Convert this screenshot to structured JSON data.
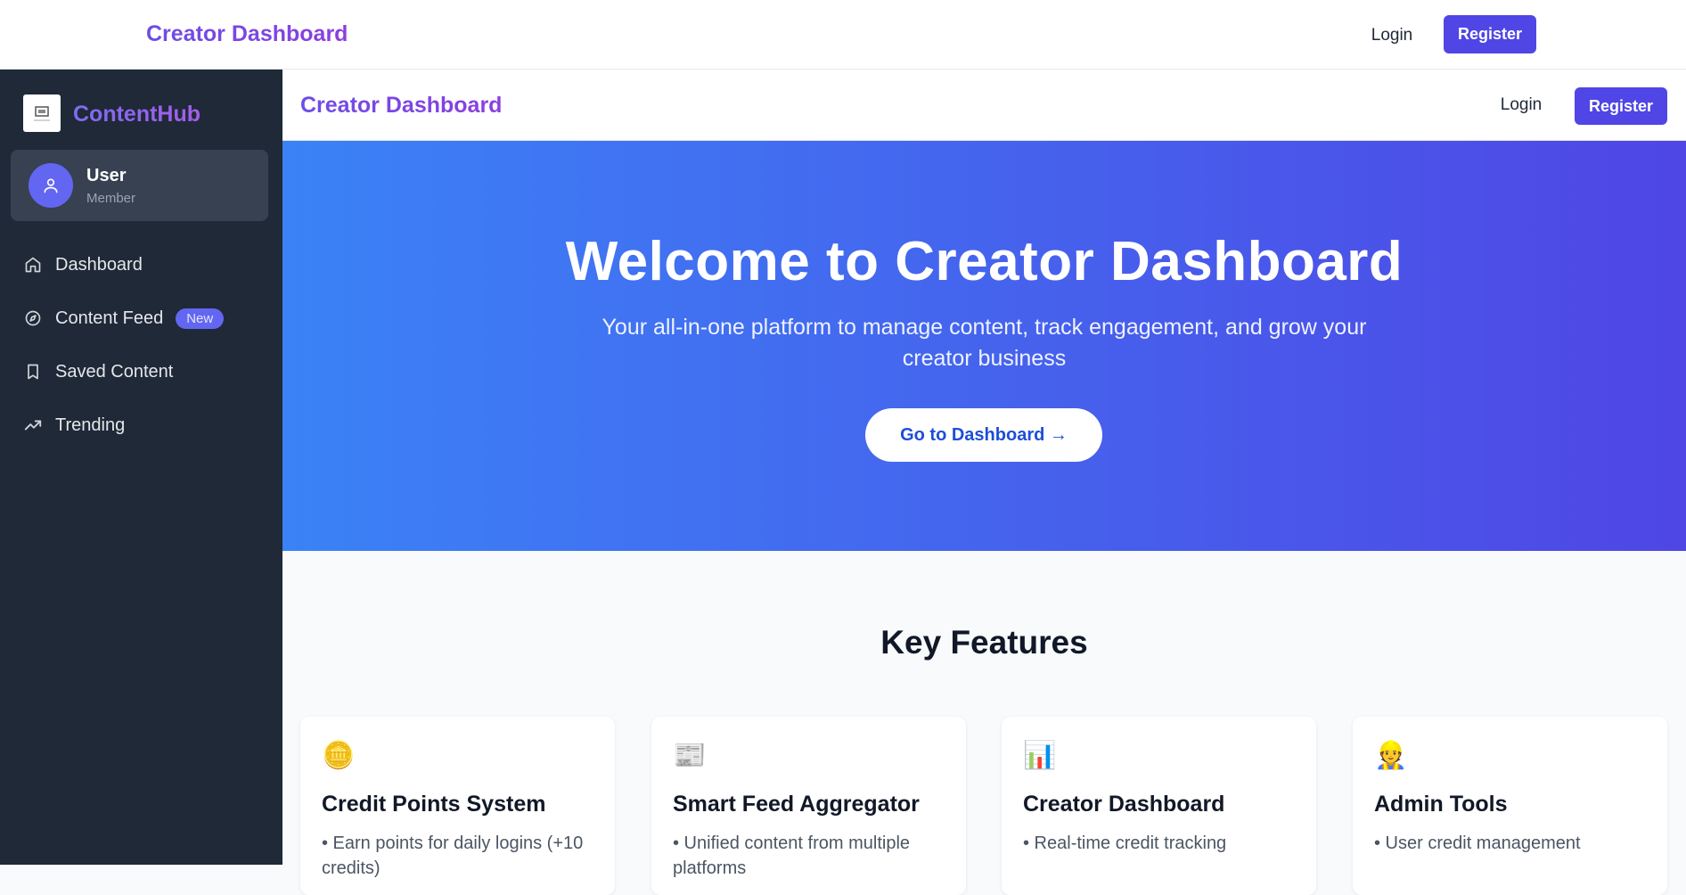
{
  "topbar": {
    "brand": "Creator Dashboard",
    "login": "Login",
    "register": "Register"
  },
  "sidebar": {
    "logo_text": "ContentHub",
    "user": {
      "name": "User",
      "role": "Member"
    },
    "items": [
      {
        "label": "Dashboard",
        "icon": "home-icon"
      },
      {
        "label": "Content Feed",
        "icon": "compass-icon",
        "badge": "New"
      },
      {
        "label": "Saved Content",
        "icon": "bookmark-icon"
      },
      {
        "label": "Trending",
        "icon": "trending-up-icon"
      }
    ]
  },
  "header": {
    "brand": "Creator Dashboard",
    "login": "Login",
    "register": "Register"
  },
  "hero": {
    "title": "Welcome to Creator Dashboard",
    "subtitle": "Your all-in-one platform to manage content, track engagement, and grow your creator business",
    "cta": "Go to Dashboard →"
  },
  "features": {
    "title": "Key Features",
    "cards": [
      {
        "emoji": "🪙",
        "title": "Credit Points System",
        "line": "• Earn points for daily logins (+10 credits)"
      },
      {
        "emoji": "📰",
        "title": "Smart Feed Aggregator",
        "line": "• Unified content from multiple platforms"
      },
      {
        "emoji": "📊",
        "title": "Creator Dashboard",
        "line": "• Real-time credit tracking"
      },
      {
        "emoji": "👷",
        "title": "Admin Tools",
        "line": "• User credit management"
      }
    ]
  },
  "colors": {
    "accent": "#4f46e5",
    "sidebar_bg": "#1f2937",
    "hero_start": "#3b82f6",
    "hero_end": "#4f46e5"
  }
}
